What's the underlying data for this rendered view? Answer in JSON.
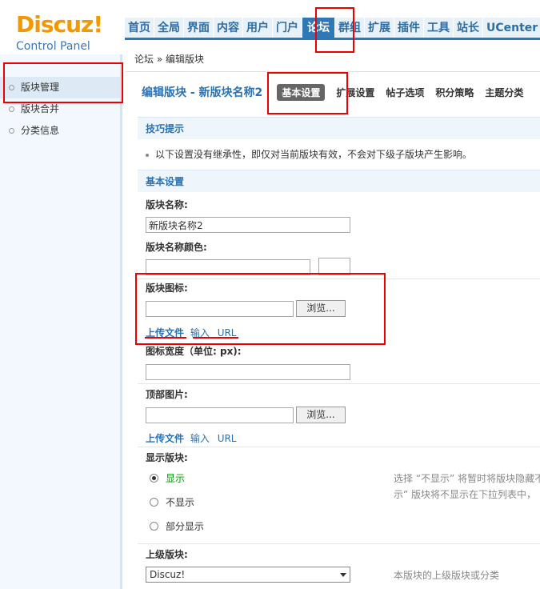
{
  "logo": {
    "brand": "Discuz!",
    "subtitle": "Control Panel"
  },
  "topnav": [
    "首页",
    "全局",
    "界面",
    "内容",
    "用户",
    "门户",
    "论坛",
    "群组",
    "扩展",
    "插件",
    "工具",
    "站长",
    "UCenter"
  ],
  "topnav_active": "论坛",
  "sidebar": {
    "items": [
      "版块管理",
      "版块合并",
      "分类信息"
    ]
  },
  "breadcrumb": "论坛 » 编辑版块",
  "page": {
    "title": "编辑版块 - 新版块名称2",
    "tabs": [
      "基本设置",
      "扩展设置",
      "帖子选项",
      "积分策略",
      "主题分类"
    ]
  },
  "tips": {
    "heading": "技巧提示",
    "text": "以下设置没有继承性，即仅对当前版块有效，不会对下级子版块产生影响。"
  },
  "basic": {
    "heading": "基本设置",
    "name_label": "版块名称:",
    "name_value": "新版块名称2",
    "color_label": "版块名称颜色:",
    "icon_label": "版块图标:",
    "browse_label": "浏览...",
    "upload_link": "上传文件",
    "input_link": "输入",
    "url_link": "URL",
    "icon_width_label": "图标宽度（单位: px):",
    "top_image_label": "顶部图片:",
    "show_label": "显示版块:",
    "show_options": [
      "显示",
      "不显示",
      "部分显示"
    ],
    "show_hint_1": "选择 “不显示” 将暂时将版块隐藏不",
    "show_hint_2": "示” 版块将不显示在下拉列表中，",
    "parent_label": "上级版块:",
    "parent_value": "Discuz!",
    "parent_hint": "本版块的上级版块或分类"
  }
}
